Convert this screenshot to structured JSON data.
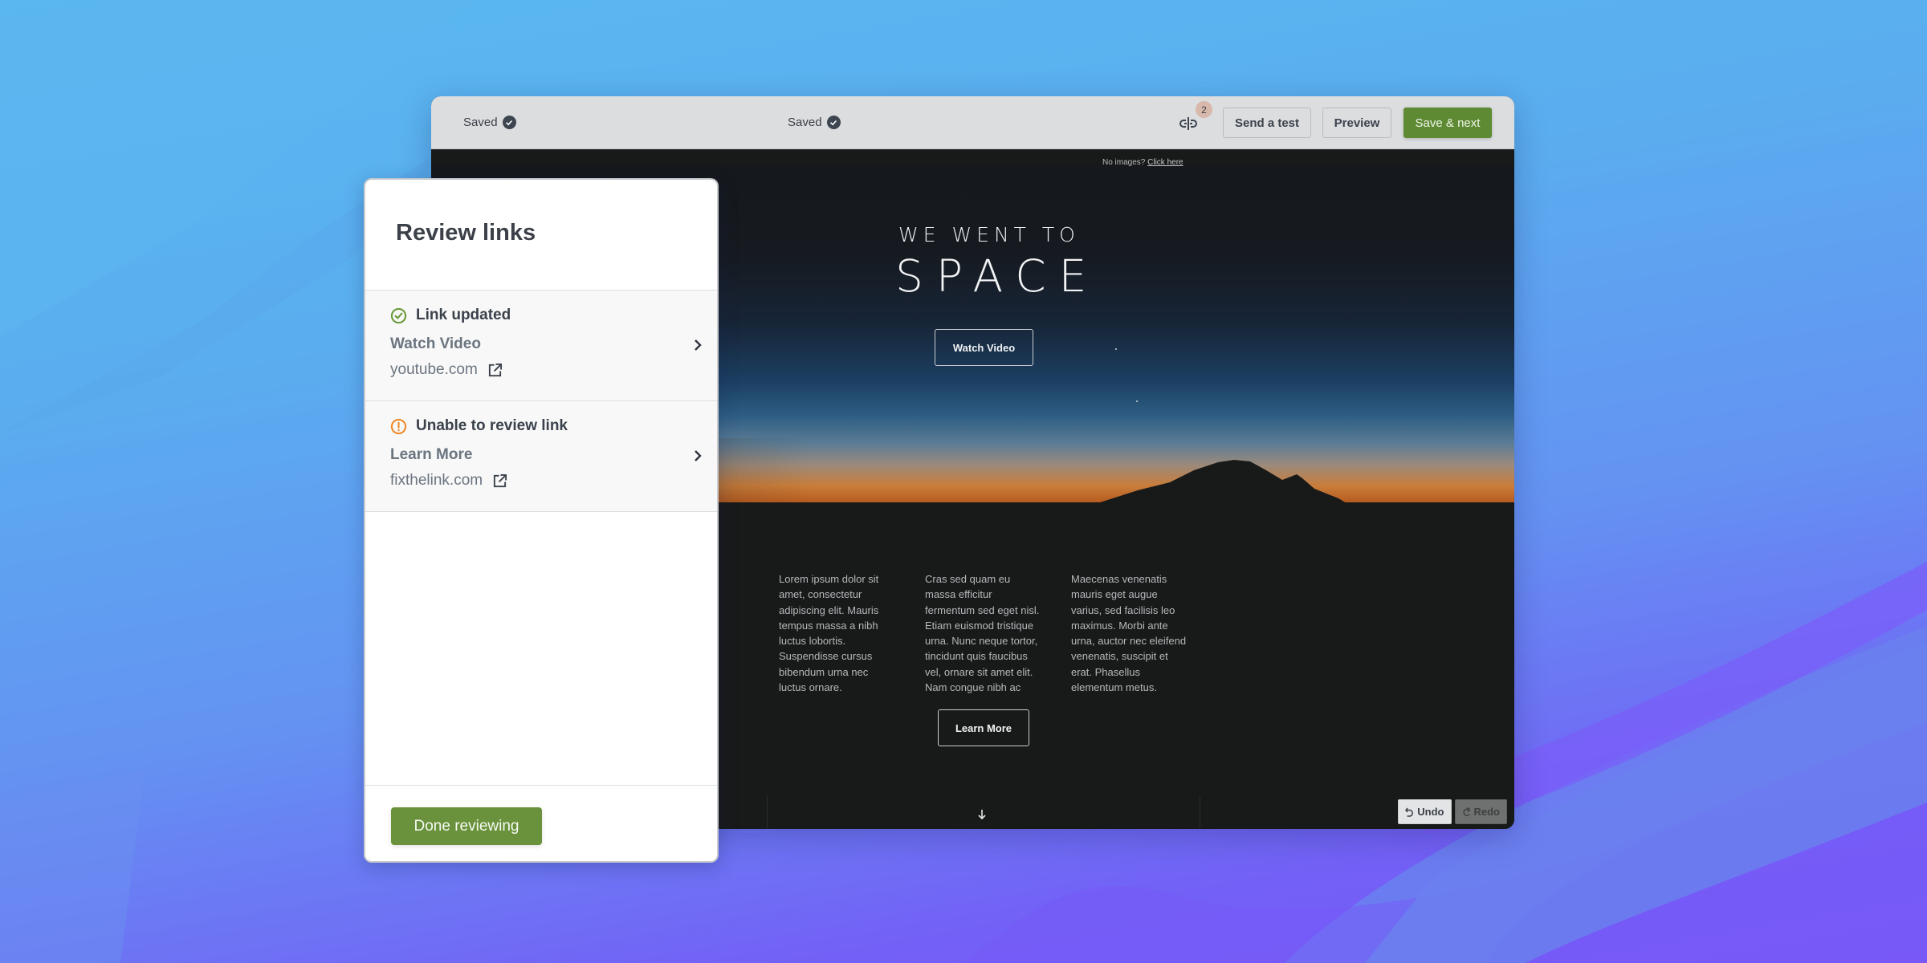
{
  "editor": {
    "status_left": "Saved",
    "status_center": "Saved",
    "link_review_badge_count": "2",
    "toolbar": {
      "send_test_label": "Send a test",
      "preview_label": "Preview",
      "save_next_label": "Save & next"
    },
    "email": {
      "no_images_prompt": "No images?",
      "no_images_link": "Click here",
      "hero_subtitle": "WE WENT TO",
      "hero_title": "SPACE",
      "hero_button_label": "Watch Video",
      "columns": [
        "Lorem ipsum dolor sit amet, consectetur adipiscing elit. Mauris tempus massa a nibh luctus lobortis. Suspendisse cursus bibendum urna nec luctus ornare.",
        "Cras sed quam eu massa efficitur fermentum sed eget nisl. Etiam euismod tristique urna. Nunc neque tortor, tincidunt quis faucibus vel, ornare sit amet elit. Nam congue nibh ac",
        "Maecenas venenatis mauris eget augue varius, sed facilisis leo maximus. Morbi ante urna, auctor nec eleifend venenatis, suscipit et erat. Phasellus elementum metus."
      ],
      "cta_button_label": "Learn More"
    },
    "undo_label": "Undo",
    "redo_label": "Redo"
  },
  "review_panel": {
    "title": "Review links",
    "items": [
      {
        "status": "Link updated",
        "status_icon": "check-circle-icon",
        "status_color": "#6a9a3a",
        "link_text": "Watch Video",
        "domain": "youtube.com"
      },
      {
        "status": "Unable to review link",
        "status_icon": "warning-circle-icon",
        "status_color": "#ef8a2a",
        "link_text": "Learn More",
        "domain": "fixthelink.com"
      }
    ],
    "done_label": "Done reviewing"
  },
  "colors": {
    "primary_green": "#5e8a34",
    "done_green": "#6a923c",
    "badge_bg": "#d9b8ac"
  }
}
